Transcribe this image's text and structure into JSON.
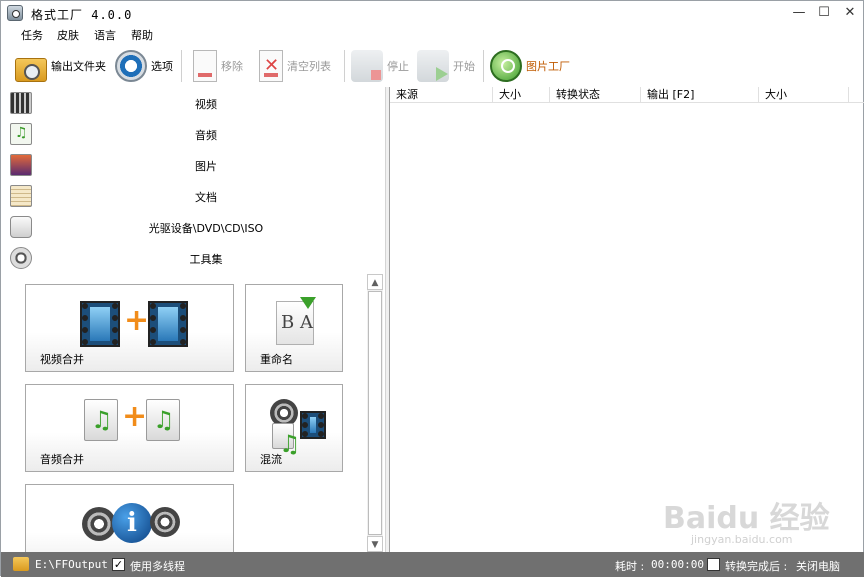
{
  "window": {
    "title": "格式工厂 4.0.0",
    "minimize": "—",
    "maximize": "☐",
    "close": "✕"
  },
  "menu": [
    "任务",
    "皮肤",
    "语言",
    "帮助"
  ],
  "toolbar": {
    "output_folder": "输出文件夹",
    "options": "选项",
    "remove": "移除",
    "clear_list": "清空列表",
    "stop": "停止",
    "start": "开始",
    "picture_factory": "图片工厂"
  },
  "categories": [
    "视频",
    "音频",
    "图片",
    "文档",
    "光驱设备\\DVD\\CD\\ISO",
    "工具集"
  ],
  "tools": {
    "video_join": "视频合并",
    "rename": "重命名",
    "audio_join": "音频合并",
    "mux": "混流"
  },
  "table": {
    "columns": [
      "来源",
      "大小",
      "转换状态",
      "输出 [F2]",
      "大小"
    ]
  },
  "status": {
    "output_path": "E:\\FFOutput",
    "multithread": "使用多线程",
    "multithread_checked": true,
    "elapsed_label": "耗时 :",
    "elapsed": "00:00:00",
    "after_convert": "转换完成后 :",
    "after_convert_checked": false,
    "shutdown": "关闭电脑"
  },
  "watermark": {
    "main": "Baidu 经验",
    "sub": "jingyan.baidu.com"
  }
}
